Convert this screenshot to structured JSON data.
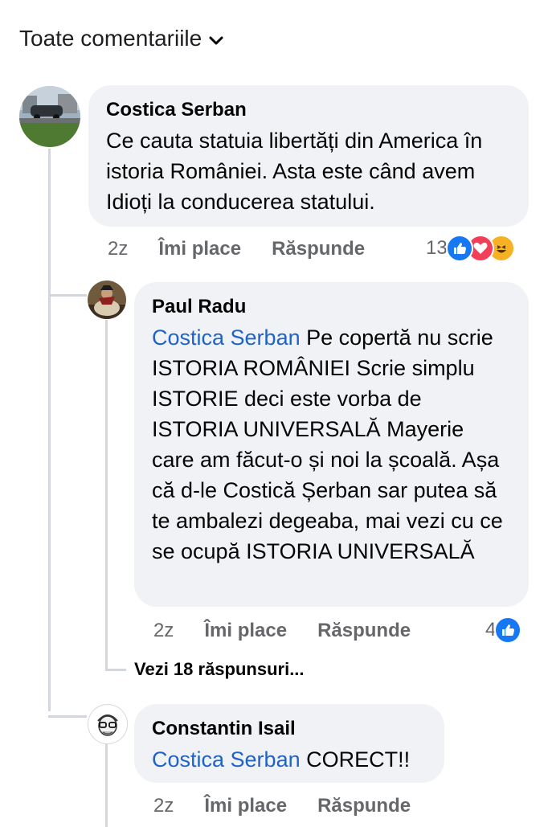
{
  "filter": {
    "label": "Toate comentariile"
  },
  "comments": [
    {
      "author": "Costica Serban",
      "text": "Ce cauta statuia libertăți din America în istoria României. Asta este când avem Idioți  la conducerea statului.",
      "time": "2z",
      "like_label": "Îmi place",
      "reply_label": "Răspunde",
      "reaction_count": "13",
      "reactions": [
        "like-icon",
        "love-icon",
        "haha-icon"
      ]
    },
    {
      "author": "Paul Radu",
      "mention": "Costica Serban",
      "text": " Pe copertă nu scrie ISTORIA ROMÂNIEI  Scrie simplu ISTORIE deci este vorba de ISTORIA UNIVERSALĂ Mayerie care am făcut-o și noi la școală. Așa  că d-le Costică Șerban sar putea să te ambalezi degeaba, mai vezi cu ce se ocupă ISTORIA UNIVERSALĂ",
      "time": "2z",
      "like_label": "Îmi place",
      "reply_label": "Răspunde",
      "reaction_count": "4",
      "reactions": [
        "like-icon"
      ],
      "view_replies": "Vezi 18 răspunsuri..."
    },
    {
      "author": "Constantin Isail",
      "mention": "Costica Serban",
      "text": " CORECT!!",
      "time": "2z",
      "like_label": "Îmi place",
      "reply_label": "Răspunde"
    }
  ],
  "colors": {
    "bubble": "#f0f2f5",
    "mention": "#1f63c6",
    "like": "#1877f2",
    "love": "#f33e58",
    "haha": "#f7b125",
    "meta": "#65676b"
  }
}
